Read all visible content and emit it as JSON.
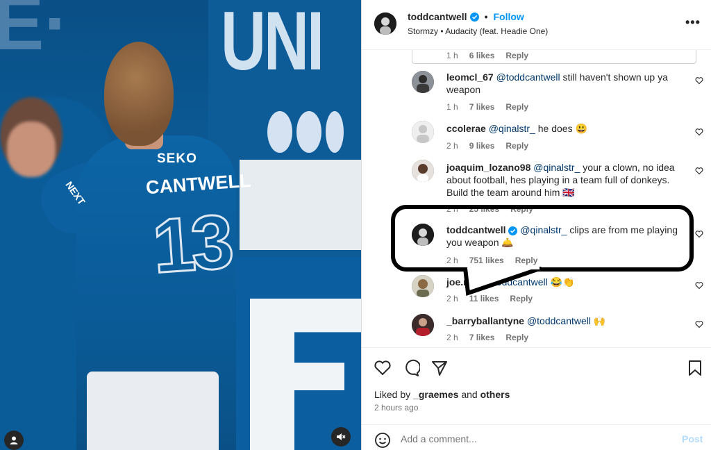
{
  "media": {
    "jersey_sponsor": "SEKO",
    "jersey_name": "CANTWELL",
    "jersey_number": "13",
    "sleeve_text": "NEXT",
    "bg_letters": "UNI",
    "user_tag_icon": "user-icon",
    "mute_icon": "speaker-muted-icon"
  },
  "header": {
    "username": "toddcantwell",
    "separator": "•",
    "follow_label": "Follow",
    "audio": "Stormzy • Audacity (feat. Headie One)",
    "more_label": "•••"
  },
  "comments": [
    {
      "user": "",
      "text": "",
      "time": "1 h",
      "likes": "6 likes",
      "reply": "Reply"
    },
    {
      "user": "leomcl_67",
      "mention": "@toddcantwell",
      "text": " still haven't shown up ya weapon",
      "time": "1 h",
      "likes": "7 likes",
      "reply": "Reply"
    },
    {
      "user": "ccolerae",
      "mention": "@qinalstr_",
      "text": " he does 😃",
      "time": "2 h",
      "likes": "9 likes",
      "reply": "Reply"
    },
    {
      "user": "joaquim_lozano98",
      "mention": "@qinalstr_",
      "text": " your a clown, no idea about football, hes playing in a team full of donkeys. Build the team around him 🇬🇧",
      "time": "2 h",
      "likes": "25 likes",
      "reply": "Reply"
    },
    {
      "user": "toddcantwell",
      "mention": "@qinalstr_",
      "text": " clips are from me playing you weapon 🛎️",
      "time": "2 h",
      "likes": "751 likes",
      "reply": "Reply"
    },
    {
      "user": "joe.rfc7",
      "mention": "@toddcantwell",
      "text": " 😂👏",
      "time": "2 h",
      "likes": "11 likes",
      "reply": "Reply"
    },
    {
      "user": "_barryballantyne",
      "mention": "@toddcantwell",
      "text": " 🙌",
      "time": "2 h",
      "likes": "7 likes",
      "reply": "Reply"
    }
  ],
  "actions": {
    "liked_prefix": "Liked by ",
    "liked_user": "_graemes",
    "liked_and": " and ",
    "liked_others": "others",
    "time_ago": "2 hours ago",
    "add_placeholder": "Add a comment...",
    "post_label": "Post"
  },
  "colors": {
    "accent": "#0095f6",
    "mention": "#00376b",
    "muted": "#737373"
  }
}
